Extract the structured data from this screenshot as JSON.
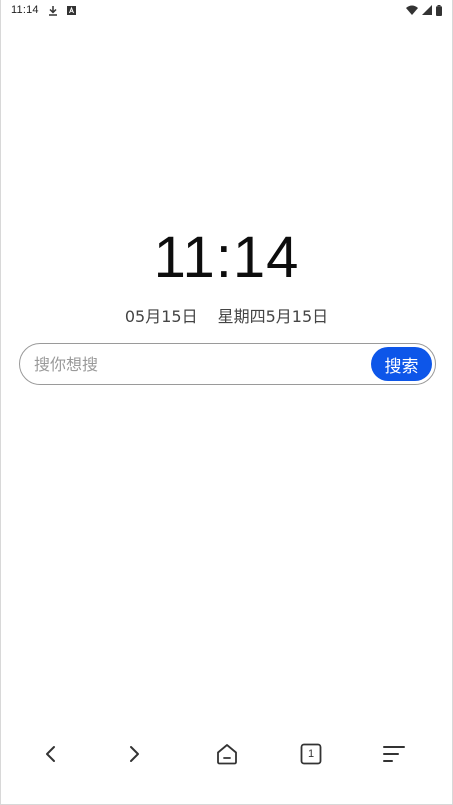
{
  "status_bar": {
    "time": "11:14",
    "icons": [
      "download-icon",
      "text-icon",
      "wifi-icon",
      "signal-icon",
      "battery-icon"
    ]
  },
  "clock": {
    "time": "11:14"
  },
  "date": {
    "short_date": "05月15日",
    "weekday_date": "星期四5月15日"
  },
  "search": {
    "placeholder": "搜你想搜",
    "button_label": "搜索",
    "button_color": "#0d56e9"
  },
  "bottom_nav": {
    "items": [
      {
        "icon": "back-icon"
      },
      {
        "icon": "forward-icon"
      },
      {
        "icon": "home-icon"
      },
      {
        "icon": "tabs-icon",
        "count": "1"
      },
      {
        "icon": "menu-icon"
      }
    ]
  }
}
